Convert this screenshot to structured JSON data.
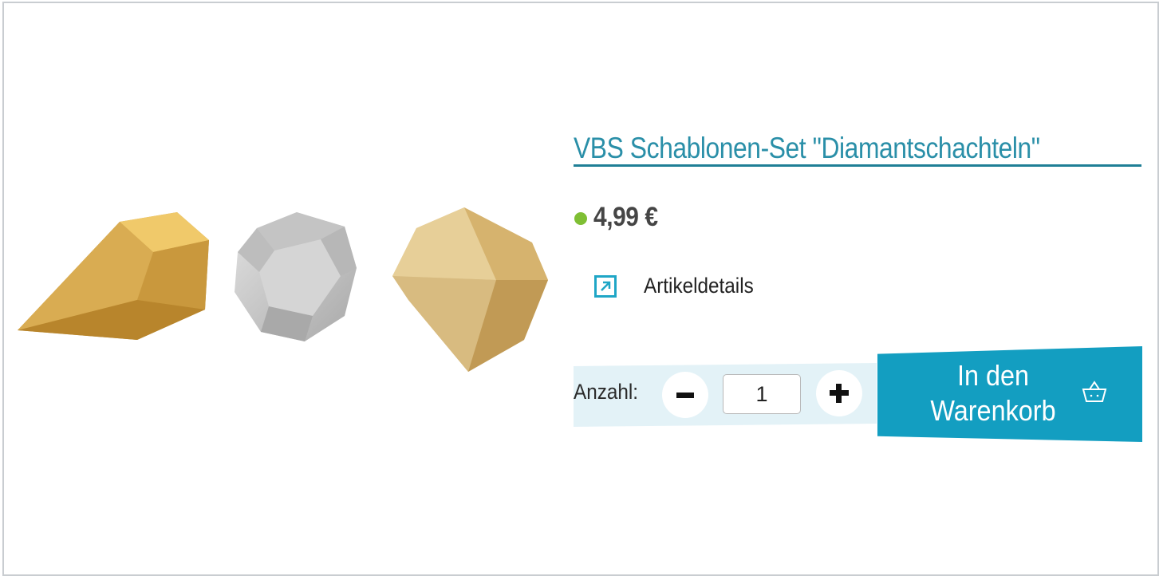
{
  "product": {
    "title": "VBS Schablonen-Set \"Diamantschachteln\"",
    "price": "4,99 €",
    "details_label": "Artikeldetails",
    "image_icon": "product-photo-diamond-boxes",
    "availability_color": "#7fbf34"
  },
  "quantity": {
    "label": "Anzahl:",
    "value": "1",
    "minus_icon": "minus-icon",
    "plus_icon": "plus-icon"
  },
  "cart": {
    "button_label_line1": "In den",
    "button_label_line2": "Warenkorb",
    "icon": "basket-icon"
  },
  "colors": {
    "accent": "#139ec1",
    "link": "#2a8fa8",
    "panel": "#e3f2f7"
  }
}
